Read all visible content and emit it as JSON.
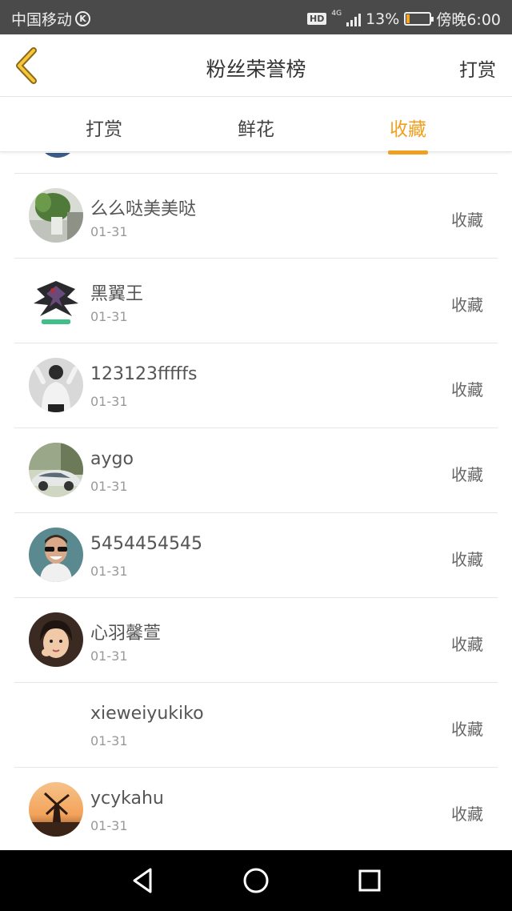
{
  "status_bar": {
    "carrier": "中国移动",
    "carrier_badge": "K",
    "hd": "HD",
    "network": "4G",
    "battery_percent": "13%",
    "battery_level": 0.13,
    "time": "傍晚6:00"
  },
  "header": {
    "title": "粉丝荣誉榜",
    "action_label": "打赏",
    "back_icon": "chevron-left-icon"
  },
  "tabs": [
    {
      "label": "打赏",
      "active": false
    },
    {
      "label": "鲜花",
      "active": false
    },
    {
      "label": "收藏",
      "active": true
    }
  ],
  "accent_color": "#f0a020",
  "list": [
    {
      "name": "么么哒美美哒",
      "date": "01-31",
      "tag": "收藏",
      "avatar": "plant"
    },
    {
      "name": "黑翼王",
      "date": "01-31",
      "tag": "收藏",
      "avatar": "dark-wings"
    },
    {
      "name": "123123fffffs",
      "date": "01-31",
      "tag": "收藏",
      "avatar": "person-grey"
    },
    {
      "name": "aygo",
      "date": "01-31",
      "tag": "收藏",
      "avatar": "car"
    },
    {
      "name": "5454454545",
      "date": "01-31",
      "tag": "收藏",
      "avatar": "sunglasses-man"
    },
    {
      "name": "心羽馨萱",
      "date": "01-31",
      "tag": "收藏",
      "avatar": "child"
    },
    {
      "name": "xieweiyukiko",
      "date": "01-31",
      "tag": "收藏",
      "avatar": "none"
    },
    {
      "name": "ycykahu",
      "date": "01-31",
      "tag": "收藏",
      "avatar": "windmill"
    }
  ],
  "nav": [
    "back-triangle-icon",
    "home-circle-icon",
    "recents-square-icon"
  ]
}
